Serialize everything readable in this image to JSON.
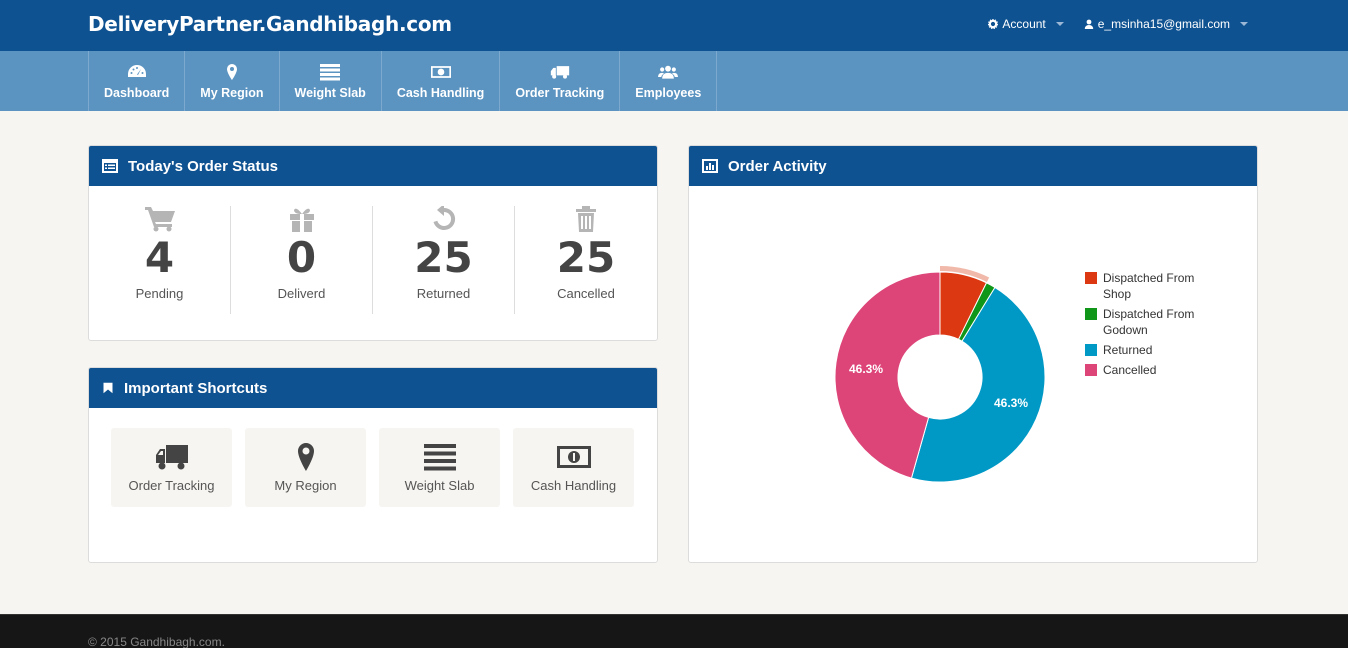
{
  "header": {
    "brand": "DeliveryPartner.Gandhibagh.com",
    "account_label": "Account",
    "user_email": "e_msinha15@gmail.com"
  },
  "nav": {
    "items": [
      {
        "label": "Dashboard",
        "icon": "dashboard-icon"
      },
      {
        "label": "My Region",
        "icon": "map-marker-icon"
      },
      {
        "label": "Weight Slab",
        "icon": "list-icon"
      },
      {
        "label": "Cash Handling",
        "icon": "money-icon"
      },
      {
        "label": "Order Tracking",
        "icon": "truck-icon"
      },
      {
        "label": "Employees",
        "icon": "users-icon"
      }
    ]
  },
  "order_status": {
    "title": "Today's Order Status",
    "stats": [
      {
        "value": "4",
        "label": "Pending",
        "icon": "cart-icon"
      },
      {
        "value": "0",
        "label": "Deliverd",
        "icon": "gift-icon"
      },
      {
        "value": "25",
        "label": "Returned",
        "icon": "undo-icon"
      },
      {
        "value": "25",
        "label": "Cancelled",
        "icon": "trash-icon"
      }
    ]
  },
  "shortcuts": {
    "title": "Important Shortcuts",
    "items": [
      {
        "label": "Order Tracking",
        "icon": "truck-icon"
      },
      {
        "label": "My Region",
        "icon": "map-marker-icon"
      },
      {
        "label": "Weight Slab",
        "icon": "list-icon"
      },
      {
        "label": "Cash Handling",
        "icon": "money-icon"
      }
    ]
  },
  "activity": {
    "title": "Order Activity"
  },
  "chart_data": {
    "type": "pie",
    "title": "",
    "series": [
      {
        "name": "Dispatched From Shop",
        "value": 4,
        "color": "#dc3912"
      },
      {
        "name": "Dispatched From Godown",
        "value": 0.8,
        "color": "#109618"
      },
      {
        "name": "Returned",
        "value": 25,
        "color": "#0099c6"
      },
      {
        "name": "Cancelled",
        "value": 25,
        "color": "#dd4477"
      }
    ],
    "data_labels": [
      "46.3%",
      "46.3%"
    ],
    "legend": "right",
    "donut": true
  },
  "footer": {
    "text": "© 2015 Gandhibagh.com."
  }
}
